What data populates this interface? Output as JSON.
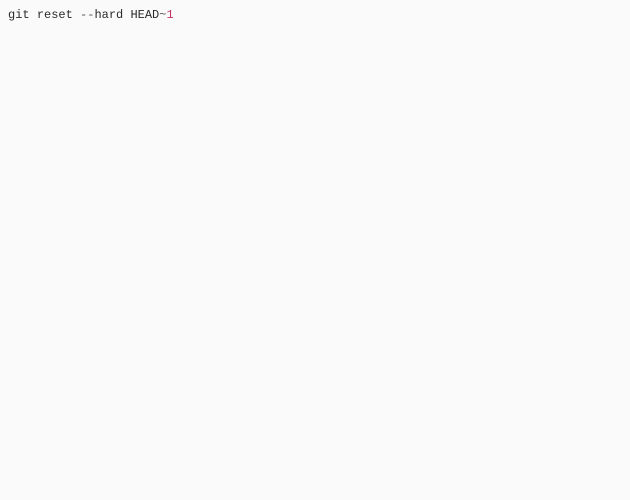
{
  "code": {
    "tokens": {
      "git": "git",
      "sp1": " ",
      "reset": "reset",
      "sp2": " ",
      "dashdash": "--",
      "hard": "hard",
      "sp3": " ",
      "head": "HEAD",
      "tilde": "~",
      "one": "1"
    }
  }
}
